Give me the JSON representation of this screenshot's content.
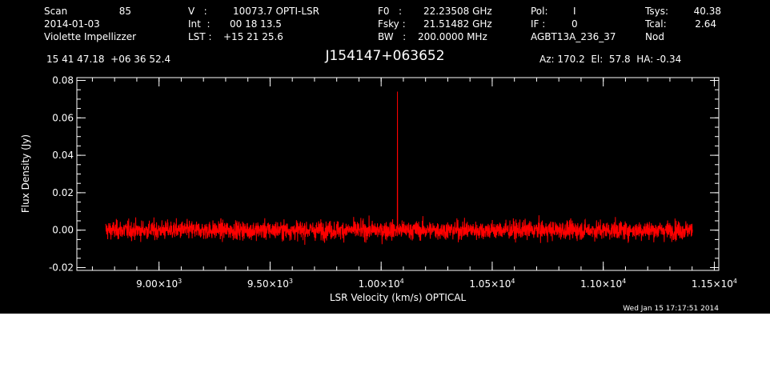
{
  "header": {
    "scan_label": "Scan",
    "scan_number": "85",
    "date": "2014-01-03",
    "observer": "Violette Impellizzer",
    "v_label": "V   :",
    "v_value": "10073.7 OPTI-LSR",
    "int_label": "Int  :",
    "int_value": "00 18 13.5",
    "lst_label": "LST :",
    "lst_value": "+15 21 25.6",
    "f0_label": "F0   :",
    "f0_value": "22.23508 GHz",
    "fsky_label": "Fsky :",
    "fsky_value": "21.51482 GHz",
    "bw_label": "BW   :",
    "bw_value": "200.0000 MHz",
    "pol_label": "Pol:",
    "pol_value": "I",
    "if_label": "IF :",
    "if_value": "0",
    "project": "AGBT13A_236_37",
    "tsys_label": "Tsys:",
    "tsys_value": "40.38",
    "tcal_label": "Tcal:",
    "tcal_value": "2.64",
    "mode": "Nod",
    "coordinates": "15 41 47.18  +06 36 52.4",
    "source": "J154147+063652",
    "pointing": "Az: 170.2  El:  57.8  HA: -0.34"
  },
  "timestamp": "Wed Jan 15 17:17:51 2014",
  "chart_data": {
    "type": "line",
    "xlabel": "LSR Velocity (km/s) OPTICAL",
    "ylabel": "Flux Density (Jy)",
    "xlim": [
      8630,
      11520
    ],
    "ylim": [
      -0.0215,
      0.0815
    ],
    "x_ticks": [
      {
        "value": 9000,
        "mantissa": "9.00×10",
        "exp": "3"
      },
      {
        "value": 9500,
        "mantissa": "9.50×10",
        "exp": "3"
      },
      {
        "value": 10000,
        "mantissa": "1.00×10",
        "exp": "4"
      },
      {
        "value": 10500,
        "mantissa": "1.05×10",
        "exp": "4"
      },
      {
        "value": 11000,
        "mantissa": "1.10×10",
        "exp": "4"
      },
      {
        "value": 11500,
        "mantissa": "1.15×10",
        "exp": "4"
      }
    ],
    "x_minor_step": 100,
    "y_ticks": [
      {
        "value": -0.02,
        "label": "-0.02"
      },
      {
        "value": 0.0,
        "label": "0.00"
      },
      {
        "value": 0.02,
        "label": "0.02"
      },
      {
        "value": 0.04,
        "label": "0.04"
      },
      {
        "value": 0.06,
        "label": "0.06"
      },
      {
        "value": 0.08,
        "label": "0.08"
      }
    ],
    "y_minor_step": 0.005,
    "grid": false,
    "series": [
      {
        "color": "#ff0000",
        "x_start": 8760,
        "x_end": 11400,
        "baseline": 0.0,
        "noise_rms": 0.0045,
        "peak_x": 10073.7,
        "peak_y": 0.074,
        "note_points_are_noise": true
      }
    ]
  }
}
